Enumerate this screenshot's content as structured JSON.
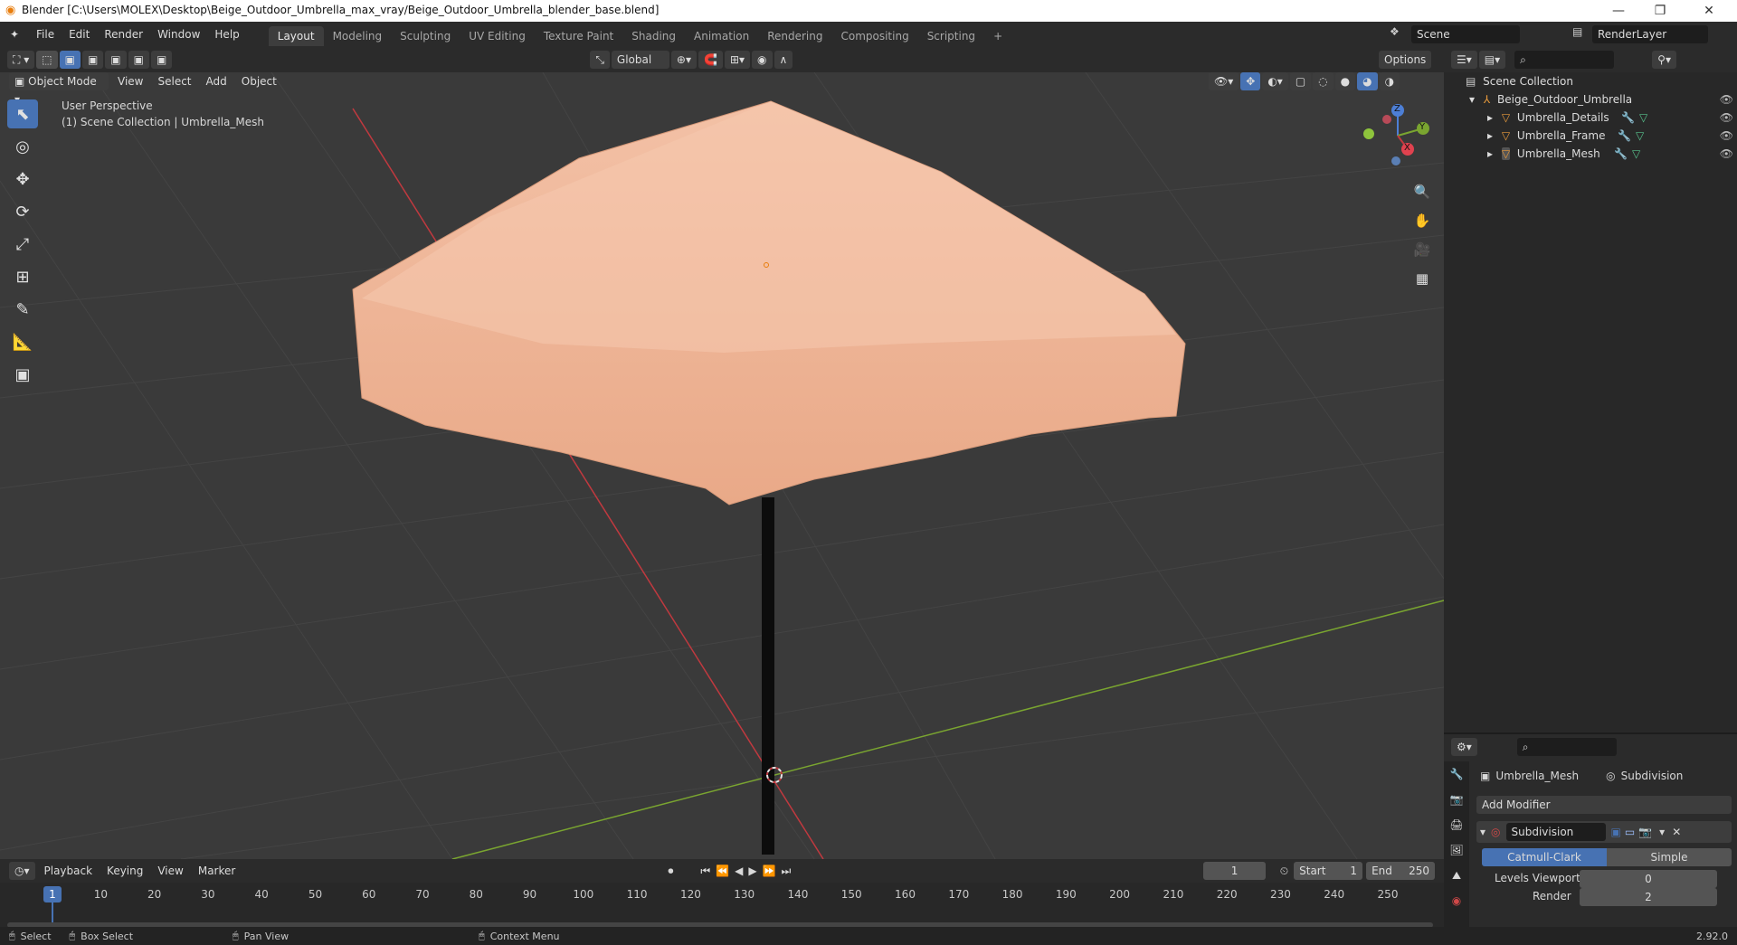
{
  "window": {
    "title": "Blender [C:\\Users\\MOLEX\\Desktop\\Beige_Outdoor_Umbrella_max_vray/Beige_Outdoor_Umbrella_blender_base.blend]",
    "min": "—",
    "max": "❐",
    "close": "✕"
  },
  "menu": [
    "File",
    "Edit",
    "Render",
    "Window",
    "Help"
  ],
  "workspaces": [
    "Layout",
    "Modeling",
    "Sculpting",
    "UV Editing",
    "Texture Paint",
    "Shading",
    "Animation",
    "Rendering",
    "Compositing",
    "Scripting",
    "+"
  ],
  "scene": {
    "label": "Scene",
    "render_layer": "RenderLayer"
  },
  "viewport": {
    "mode": "Object Mode",
    "menus": [
      "View",
      "Select",
      "Add",
      "Object"
    ],
    "transform": "Global",
    "options": "Options",
    "perspective": "User Perspective",
    "collection_info": "(1) Scene Collection | Umbrella_Mesh",
    "gizmo": {
      "z": "Z",
      "y": "Y",
      "x": "X"
    }
  },
  "outliner": {
    "root": "Scene Collection",
    "collection": "Beige_Outdoor_Umbrella",
    "objects": [
      "Umbrella_Details",
      "Umbrella_Frame",
      "Umbrella_Mesh"
    ]
  },
  "properties": {
    "object": "Umbrella_Mesh",
    "modifier_tab": "Subdivision",
    "add_modifier": "Add Modifier",
    "modifier_name": "Subdivision",
    "mode_a": "Catmull-Clark",
    "mode_b": "Simple",
    "levels_label": "Levels Viewport",
    "levels_value": "0",
    "render_label": "Render",
    "render_value": "2"
  },
  "timeline": {
    "menus": [
      "Playback",
      "Keying",
      "View",
      "Marker"
    ],
    "current": "1",
    "start_label": "Start",
    "start": "1",
    "end_label": "End",
    "end": "250",
    "ticks": [
      "1",
      "10",
      "20",
      "30",
      "40",
      "50",
      "60",
      "70",
      "80",
      "90",
      "100",
      "110",
      "120",
      "130",
      "140",
      "150",
      "160",
      "170",
      "180",
      "190",
      "200",
      "210",
      "220",
      "230",
      "240",
      "250"
    ]
  },
  "status": {
    "select": "Select",
    "box_select": "Box Select",
    "pan": "Pan View",
    "context": "Context Menu",
    "version": "2.92.0"
  },
  "colors": {
    "accent": "#4772b3",
    "canopy": "#f0b597",
    "x_axis": "#c0393f",
    "y_axis": "#7aa530"
  }
}
